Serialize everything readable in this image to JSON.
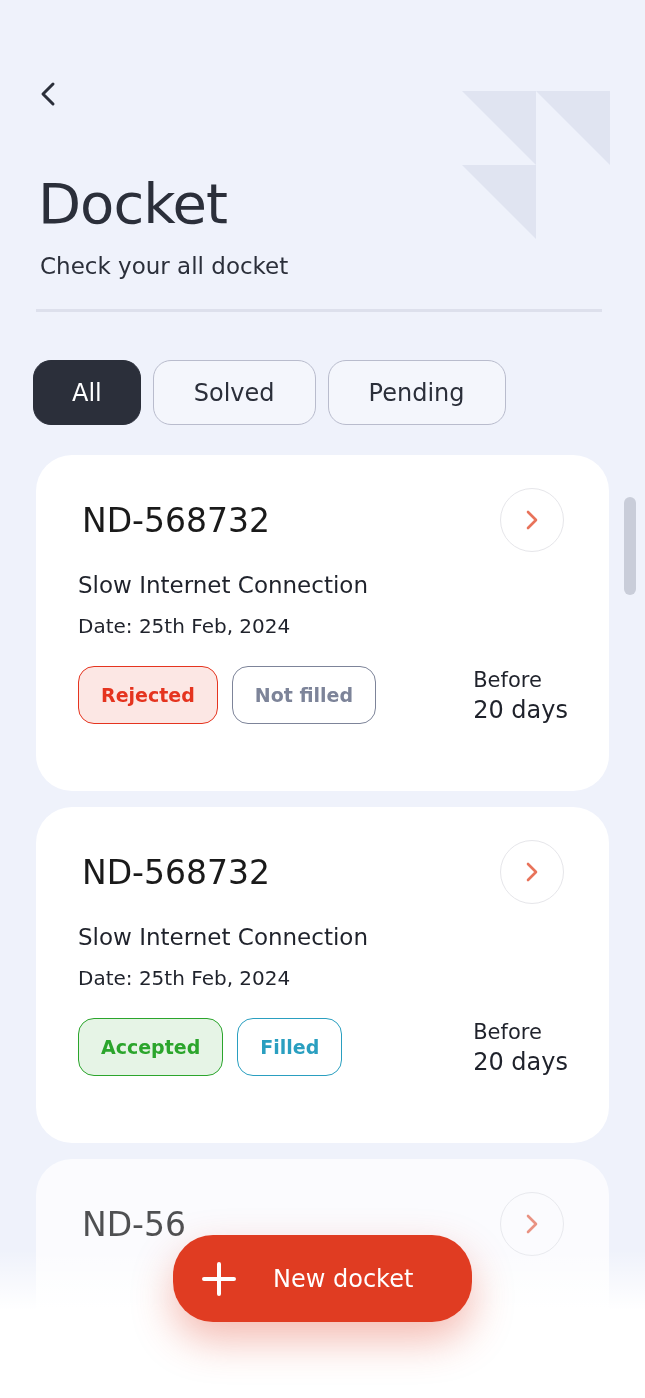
{
  "header": {
    "title": "Docket",
    "subtitle": "Check your all docket"
  },
  "filters": [
    {
      "label": "All",
      "selected": true
    },
    {
      "label": "Solved",
      "selected": false
    },
    {
      "label": "Pending",
      "selected": false
    }
  ],
  "dockets": [
    {
      "id": "ND-568732",
      "faded": false,
      "title": "Slow Internet Connection",
      "date": "Date: 25th Feb, 2024",
      "tags": [
        {
          "label": "Rejected",
          "color": "#e5341f",
          "tinted": true
        },
        {
          "label": "Not filled",
          "color": "#7d8499",
          "tinted": false
        }
      ],
      "due_label": "Before",
      "due_value": "20 days"
    },
    {
      "id": "ND-568732",
      "faded": false,
      "title": "Slow Internet Connection",
      "date": "Date: 25th Feb, 2024",
      "tags": [
        {
          "label": "Accepted",
          "color": "#2ba52c",
          "tinted": true
        },
        {
          "label": "Filled",
          "color": "#2a9fc0",
          "tinted": false
        }
      ],
      "due_label": "Before",
      "due_value": "20 days"
    },
    {
      "id": "ND-56",
      "faded": true
    }
  ],
  "new_button": {
    "label": "New docket"
  }
}
